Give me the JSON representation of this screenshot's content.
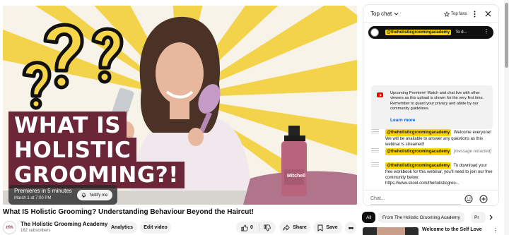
{
  "player": {
    "thumbnail_headline": [
      "WHAT IS",
      "HOLISTIC",
      "GROOMING?!"
    ],
    "premiere_text": "Premieres in 5 minutes",
    "premiere_date": "March 1 at 7:00 PM",
    "notify_label": "Notify me",
    "bottle_label": "Mitchell"
  },
  "video": {
    "title": "What IS Holistic Grooming? Understanding Behaviour Beyond the Haircut!",
    "channel_logo_line1": "HGA",
    "channel_logo_line2": "HOLISTIC",
    "channel_name": "The Holistic Grooming Academy",
    "subscribers": "162 subscribers",
    "analytics_label": "Analytics",
    "edit_label": "Edit video",
    "like_count": "0",
    "share_label": "Share",
    "save_label": "Save"
  },
  "chat": {
    "header_title": "Top chat",
    "top_fans_label": "Top fans",
    "pinned": {
      "handle": "@theholisticgroomingacademy",
      "text": "To d..."
    },
    "banner": {
      "message": "Upcoming Premiere! Watch and chat live with other viewers as this upload is shown for the very first time. Remember to guard your privacy and abide by our community guidelines.",
      "learn_more": "Learn more"
    },
    "messages": [
      {
        "handle": "@theholisticgroomingacademy",
        "text": "Welcome everyone! We will be available to answer any questions as this webinar is streamed!"
      },
      {
        "handle": "@theholisticgroomingacademy",
        "text": "[message retracted]"
      },
      {
        "handle": "@theholisticgroomingacademy",
        "text": "To download your free workbook for this webinar, you'll need to join our free community below: https://www.skool.com/theholisticgroo..."
      }
    ],
    "input_placeholder": "Chat..."
  },
  "chips": [
    "All",
    "From The Holistic Grooming Academy",
    "Pr"
  ],
  "recommendation": {
    "title": "Welcome to the Self Love"
  },
  "colors": {
    "headline_bg": "#6b2637",
    "sunburst": "#f3d34a",
    "handle_highlight": "#ffd600",
    "link": "#065fd4",
    "youtube_red": "#ff0000"
  }
}
